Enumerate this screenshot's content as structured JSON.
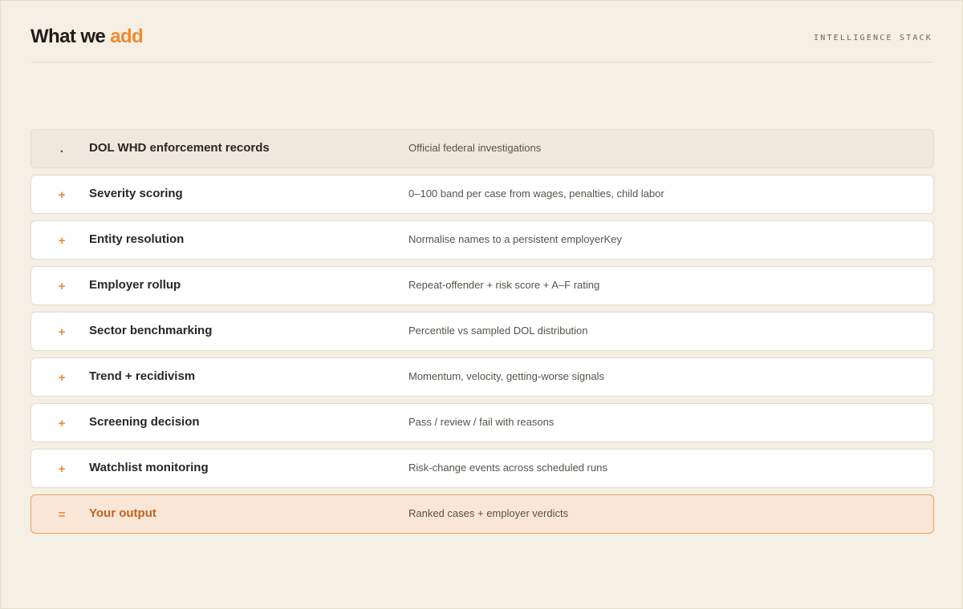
{
  "header": {
    "title_prefix": "What we ",
    "title_accent": "add",
    "tagline": "INTELLIGENCE STACK"
  },
  "colors": {
    "accent": "#ef8a2f",
    "background": "#f5efe4",
    "output_background": "#f9e6d6",
    "output_border": "#eea05e",
    "output_text": "#c0641e"
  },
  "rows": [
    {
      "symbol": ".",
      "label": "DOL WHD enforcement records",
      "description": "Official federal investigations",
      "kind": "source"
    },
    {
      "symbol": "+",
      "label": "Severity scoring",
      "description": "0–100 band per case from wages, penalties, child labor",
      "kind": "step"
    },
    {
      "symbol": "+",
      "label": "Entity resolution",
      "description": "Normalise names to a persistent employerKey",
      "kind": "step"
    },
    {
      "symbol": "+",
      "label": "Employer rollup",
      "description": "Repeat-offender + risk score + A–F rating",
      "kind": "step"
    },
    {
      "symbol": "+",
      "label": "Sector benchmarking",
      "description": "Percentile vs sampled DOL distribution",
      "kind": "step"
    },
    {
      "symbol": "+",
      "label": "Trend + recidivism",
      "description": "Momentum, velocity, getting-worse signals",
      "kind": "step"
    },
    {
      "symbol": "+",
      "label": "Screening decision",
      "description": "Pass / review / fail with reasons",
      "kind": "step"
    },
    {
      "symbol": "+",
      "label": "Watchlist monitoring",
      "description": "Risk-change events across scheduled runs",
      "kind": "step"
    },
    {
      "symbol": "=",
      "label": "Your output",
      "description": "Ranked cases + employer verdicts",
      "kind": "output"
    }
  ]
}
